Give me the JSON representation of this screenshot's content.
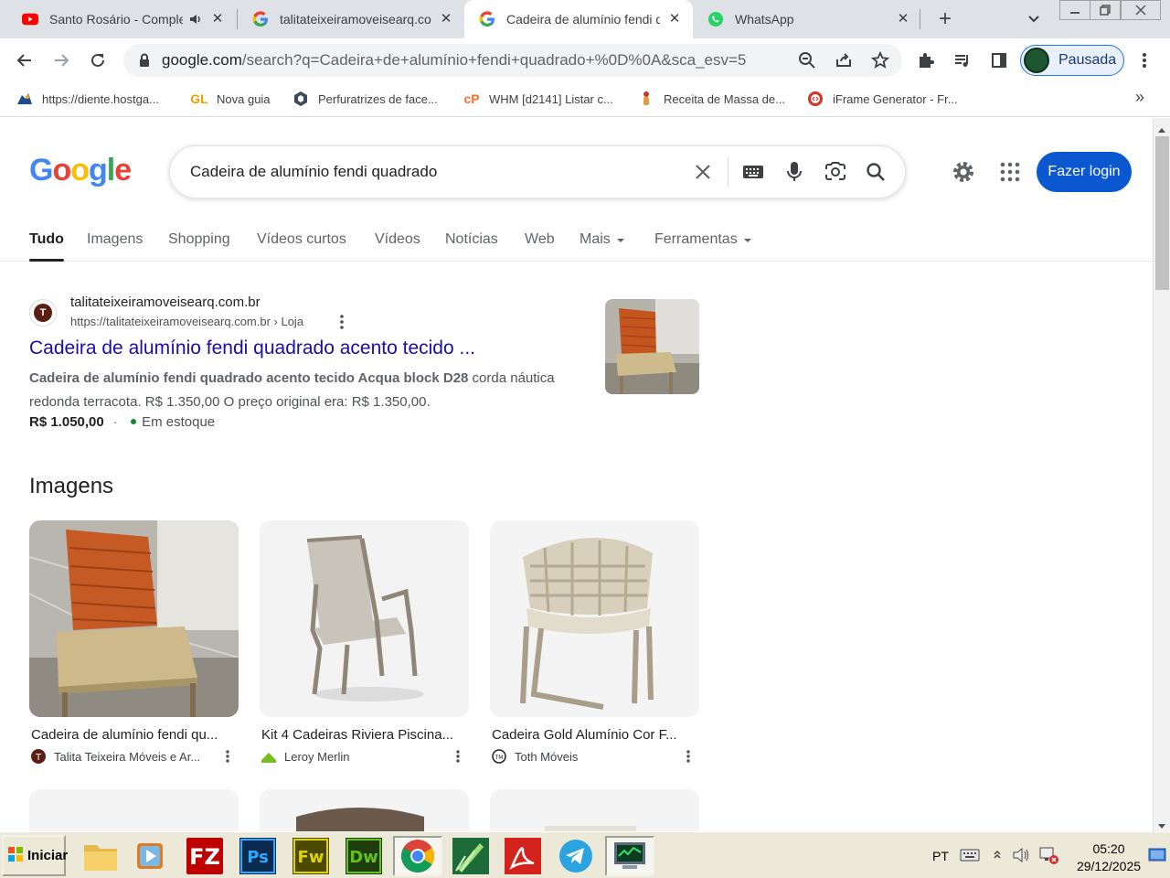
{
  "browser": {
    "tabs": [
      {
        "title": "Santo Rosário - Comple",
        "favicon": "youtube-icon"
      },
      {
        "title": "talitateixeiramoveisearq.con",
        "favicon": "google-icon"
      },
      {
        "title": "Cadeira de alumínio fendi qu",
        "favicon": "google-icon"
      },
      {
        "title": "WhatsApp",
        "favicon": "whatsapp-icon"
      }
    ],
    "url_domain": "google.com",
    "url_rest": "/search?q=Cadeira+de+alumínio+fendi+quadrado+%0D%0A&sca_esv=5f...",
    "profile_label": "Pausada",
    "bookmarks": [
      {
        "label": "https://diente.hostga..."
      },
      {
        "label": "Nova guia"
      },
      {
        "label": "Perfuratrizes de face..."
      },
      {
        "label": "WHM [d2141] Listar c..."
      },
      {
        "label": "Receita de Massa de..."
      },
      {
        "label": "iFrame Generator - Fr..."
      }
    ]
  },
  "google": {
    "logo_letters": [
      "G",
      "o",
      "o",
      "g",
      "l",
      "e"
    ],
    "query": "Cadeira de alumínio fendi quadrado",
    "login_label": "Fazer login",
    "tabs": [
      "Tudo",
      "Imagens",
      "Shopping",
      "Vídeos curtos",
      "Vídeos",
      "Notícias",
      "Web",
      "Mais",
      "Ferramentas"
    ]
  },
  "result": {
    "site_name": "talitateixeiramoveisearq.com.br",
    "site_url": "https://talitateixeiramoveisearq.com.br › Loja",
    "title": "Cadeira de alumínio fendi quadrado acento tecido ...",
    "snippet_bold": "Cadeira de alumínio fendi quadrado acento tecido Acqua block D28",
    "snippet_rest": " corda náutica redonda terracota. R$ 1.350,00 O preço original era: R$ 1.350,00.",
    "price": "R$ 1.050,00",
    "stock": "Em estoque"
  },
  "images": {
    "heading": "Imagens",
    "items": [
      {
        "caption": "Cadeira de alumínio fendi qu...",
        "source": "Talita Teixeira Móveis e Ar..."
      },
      {
        "caption": "Kit 4 Cadeiras Riviera Piscina...",
        "source": "Leroy Merlin"
      },
      {
        "caption": "Cadeira Gold Alumínio Cor F...",
        "source": "Toth Móveis"
      }
    ]
  },
  "taskbar": {
    "start_label": "Iniciar",
    "language": "PT",
    "time": "05:20",
    "date": "29/12/2025"
  }
}
